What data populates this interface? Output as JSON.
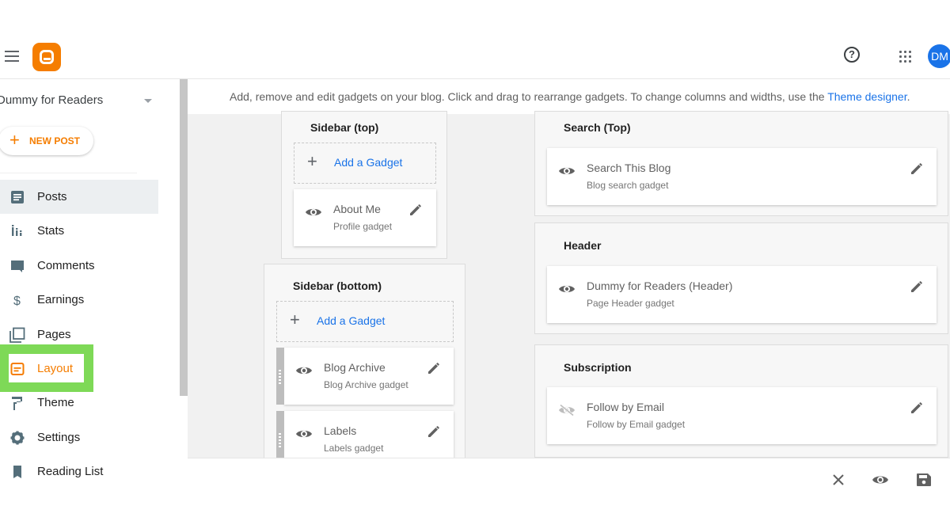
{
  "header": {
    "menu_icon": "hamburger-menu-icon",
    "logo": "blogger-logo",
    "help_glyph": "?",
    "avatar_initials": "DM"
  },
  "sidebar": {
    "blog_name": "Dummy for Readers",
    "new_post_plus": "+",
    "new_post_label": "NEW POST",
    "items": [
      {
        "label": "Posts",
        "icon": "posts-icon",
        "active": true
      },
      {
        "label": "Stats",
        "icon": "stats-icon"
      },
      {
        "label": "Comments",
        "icon": "comments-icon"
      },
      {
        "label": "Earnings",
        "icon": "earnings-icon"
      },
      {
        "label": "Pages",
        "icon": "pages-icon"
      },
      {
        "label": "Layout",
        "icon": "layout-icon",
        "highlighted": true
      },
      {
        "label": "Theme",
        "icon": "theme-icon"
      },
      {
        "label": "Settings",
        "icon": "settings-icon"
      },
      {
        "label": "Reading List",
        "icon": "reading-list-icon"
      }
    ]
  },
  "main": {
    "description": "Add, remove and edit gadgets on your blog. Click and drag to rearrange gadgets. To change columns and widths, use the ",
    "theme_designer_link": "Theme designer",
    "description_end": ".",
    "add_gadget_plus": "+",
    "sections": {
      "sidebar_top": {
        "title": "Sidebar (top)",
        "add_gadget_label": "Add a Gadget",
        "gadgets": [
          {
            "name": "About Me",
            "type": "Profile gadget",
            "visible": true
          }
        ]
      },
      "sidebar_bottom": {
        "title": "Sidebar (bottom)",
        "add_gadget_label": "Add a Gadget",
        "gadgets": [
          {
            "name": "Blog Archive",
            "type": "Blog Archive gadget",
            "visible": true
          },
          {
            "name": "Labels",
            "type": "Labels gadget",
            "visible": true
          }
        ]
      },
      "search_top": {
        "title": "Search (Top)",
        "gadgets": [
          {
            "name": "Search This Blog",
            "type": "Blog search gadget",
            "visible": true
          }
        ]
      },
      "header": {
        "title": "Header",
        "gadgets": [
          {
            "name": "Dummy for Readers (Header)",
            "type": "Page Header gadget",
            "visible": true
          }
        ]
      },
      "subscription": {
        "title": "Subscription",
        "gadgets": [
          {
            "name": "Follow by Email",
            "type": "Follow by Email gadget",
            "visible": false
          }
        ]
      }
    }
  },
  "bottombar": {
    "close": "close-icon",
    "preview": "preview-eye-icon",
    "save": "save-icon"
  },
  "colors": {
    "brand_orange": "#f57d00",
    "link_blue": "#1a73e8",
    "highlight_green": "#7ed957",
    "avatar_blue": "#1a73e8"
  }
}
